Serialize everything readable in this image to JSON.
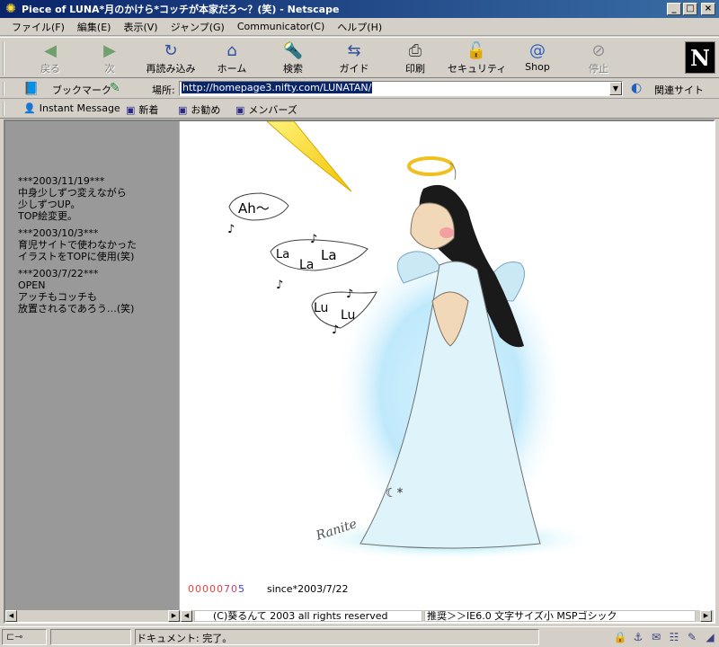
{
  "window": {
    "title": "Piece of LUNA*月のかけら*コッチが本家だろ～？(笑) - Netscape"
  },
  "menu": [
    "ファイル(F)",
    "編集(E)",
    "表示(V)",
    "ジャンプ(G)",
    "Communicator(C)",
    "ヘルプ(H)"
  ],
  "toolbar": {
    "back": "戻る",
    "forward": "次",
    "reload": "再読み込み",
    "home": "ホーム",
    "search": "検索",
    "guide": "ガイド",
    "print": "印刷",
    "security": "セキュリティ",
    "shop": "Shop",
    "stop": "停止"
  },
  "location": {
    "bookmarks_label": "ブックマーク",
    "location_label": "場所:",
    "url": "http://homepage3.nifty.com/LUNATAN/",
    "related_label": "関連サイト"
  },
  "personal": [
    "Instant Message",
    "新着",
    "お勧め",
    "メンバーズ"
  ],
  "news": [
    {
      "date": "***2003/11/19***",
      "lines": [
        "中身少しずつ変えながら",
        "少しずつUP。",
        "TOP絵変更。"
      ]
    },
    {
      "date": "***2003/10/3***",
      "lines": [
        "育児サイトで使わなかった",
        "イラストをTOPに使用(笑)"
      ]
    },
    {
      "date": "***2003/7/22***",
      "lines": [
        "OPEN",
        "アッチもコッチも",
        "放置されるであろう…(笑)"
      ]
    }
  ],
  "illustration": {
    "bubble1": "Ah～",
    "bubble2": [
      "La",
      "La",
      "La"
    ],
    "bubble3": [
      "Lu",
      "Lu"
    ],
    "signature": "Ranite"
  },
  "counter": {
    "red": "00000",
    "mid": "70",
    "blue": "5"
  },
  "since": "since*2003/7/22",
  "footer": {
    "copyright": "(C)葵るんて 2003 all rights reserved",
    "recommend": "推奨＞＞IE6.0  文字サイズ小  MSPゴシック"
  },
  "status": {
    "text": "ドキュメント: 完了。"
  },
  "colors": {
    "titlebar": "#0a246a",
    "chrome": "#d4d0c8",
    "left_frame": "#999999",
    "counter_red": "#e04040",
    "counter_blue": "#4040e0"
  }
}
